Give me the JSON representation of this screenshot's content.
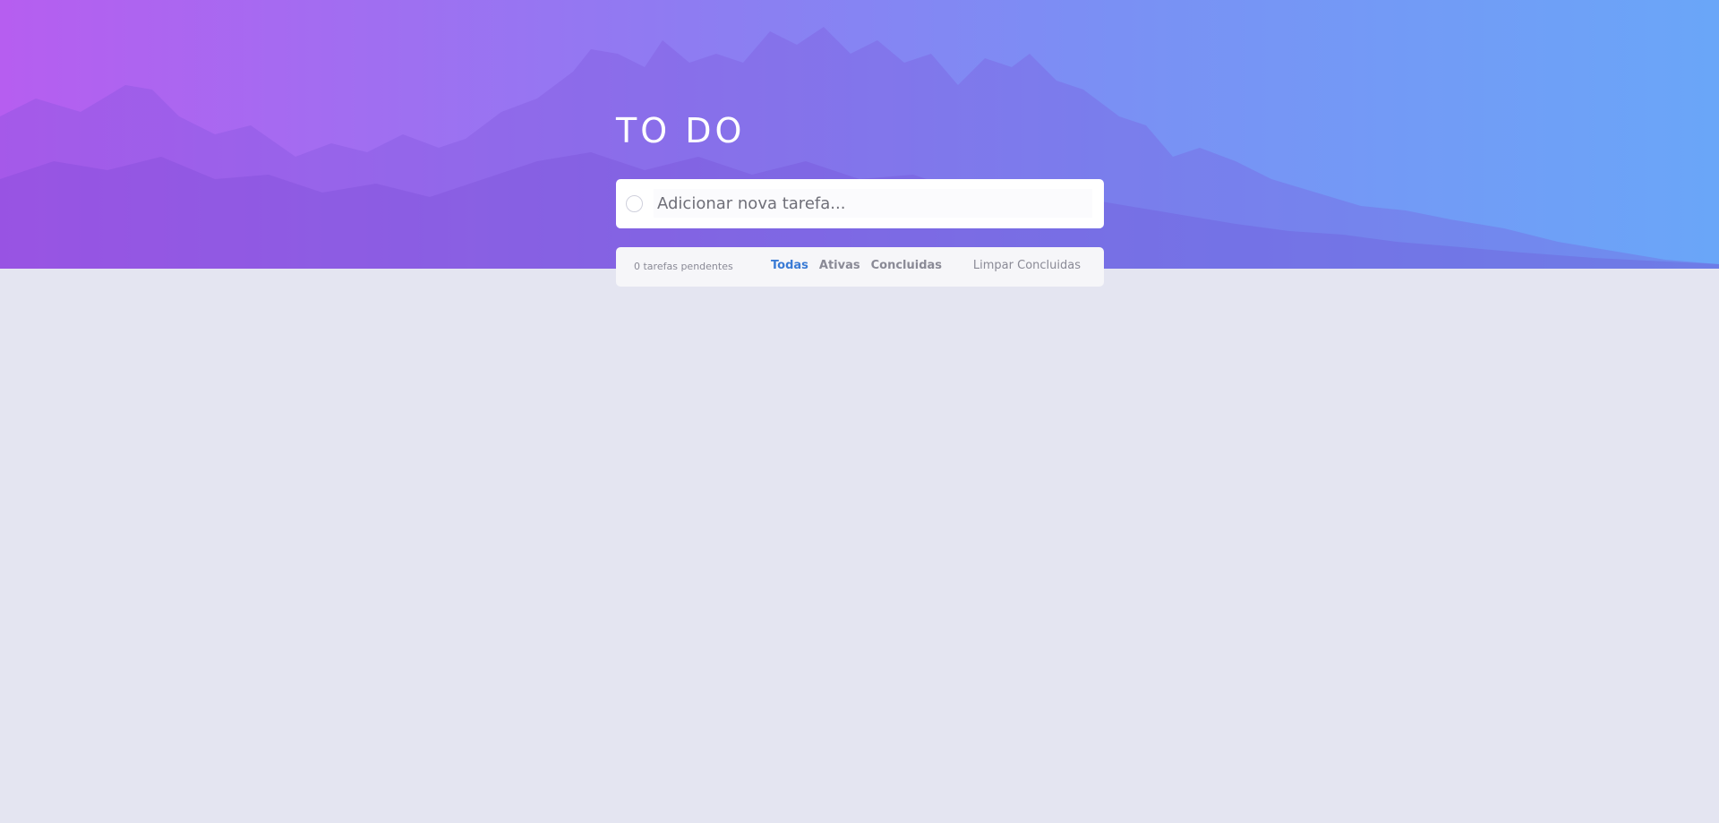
{
  "header": {
    "title": "TO DO"
  },
  "new_todo": {
    "placeholder": "Adicionar nova tarefa...",
    "value": ""
  },
  "footer": {
    "pending_count": "0 tarefas pendentes",
    "filters": [
      {
        "label": "Todas",
        "active": true
      },
      {
        "label": "Ativas",
        "active": false
      },
      {
        "label": "Concluidas",
        "active": false
      }
    ],
    "clear_label": "Limpar Concluidas"
  },
  "colors": {
    "background": "#e4e5f1",
    "gradient_start": "#b65ef0",
    "gradient_end": "#6aa6f8",
    "active_filter": "#3a7bd5",
    "muted_text": "#8a8a96"
  }
}
